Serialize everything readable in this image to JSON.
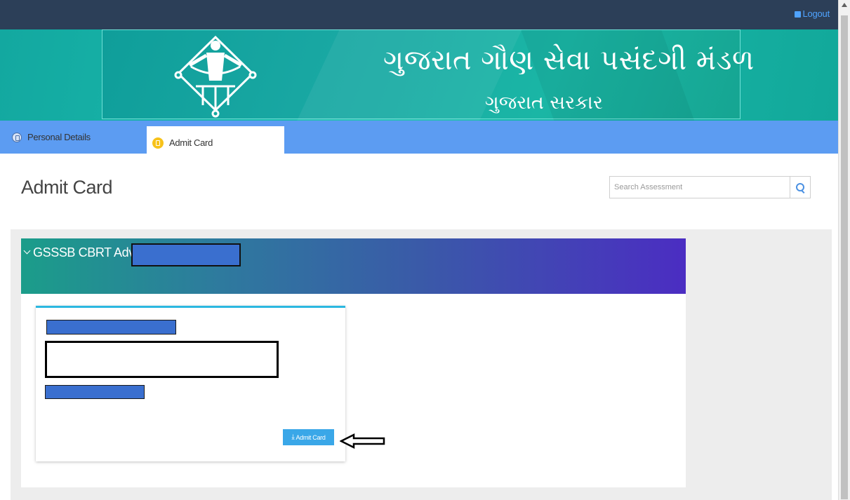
{
  "header": {
    "logout_label": "Logout",
    "logout_icon": "sign-out-icon"
  },
  "banner": {
    "title": "ગુજરાત ગૌણ સેવા પસંદગી મંડળ",
    "subtitle": "ગુજરાત સરકાર",
    "emblem": "gsssb-emblem-icon",
    "colors": {
      "primary": "#13a8a0",
      "accent": "#1ab6a5"
    }
  },
  "nav": {
    "tabs": [
      {
        "label": "Personal Details",
        "icon": "document-icon",
        "active": false
      },
      {
        "label": "Admit Card",
        "icon": "document-icon",
        "active": true
      }
    ],
    "color": "#5c9cf2"
  },
  "page": {
    "title": "Admit Card"
  },
  "search": {
    "placeholder": "Search Assessment",
    "icon": "search-icon"
  },
  "assessment": {
    "title": "GSSSB CBRT Adv",
    "expanded": true,
    "card": {
      "download_label": "Admit Card",
      "download_icon": "download-icon"
    }
  },
  "colors": {
    "topbar": "#2c3f58",
    "button": "#3aa7e8",
    "redaction": "#3a6fcf"
  }
}
